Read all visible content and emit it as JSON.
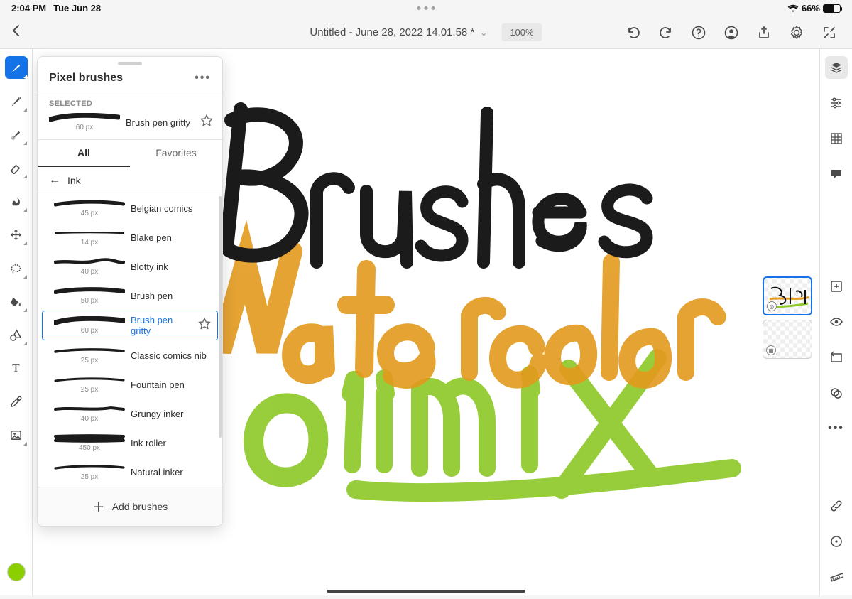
{
  "status": {
    "time": "2:04 PM",
    "date": "Tue Jun 28",
    "battery_pct": "66%"
  },
  "header": {
    "title": "Untitled - June 28, 2022 14.01.58 *",
    "zoom": "100%"
  },
  "popover": {
    "title": "Pixel brushes",
    "selected_label": "SELECTED",
    "tabs": {
      "all": "All",
      "favorites": "Favorites"
    },
    "category": "Ink",
    "selected_brush": {
      "name": "Brush pen gritty",
      "size": "60 px"
    },
    "brushes": [
      {
        "name": "Belgian comics",
        "size": "45 px"
      },
      {
        "name": "Blake pen",
        "size": "14 px"
      },
      {
        "name": "Blotty ink",
        "size": "40 px"
      },
      {
        "name": "Brush pen",
        "size": "50 px"
      },
      {
        "name": "Brush pen gritty",
        "size": "60 px"
      },
      {
        "name": "Classic comics nib",
        "size": "25 px"
      },
      {
        "name": "Fountain pen",
        "size": "25 px"
      },
      {
        "name": "Grungy inker",
        "size": "40 px"
      },
      {
        "name": "Ink roller",
        "size": "450 px"
      },
      {
        "name": "Natural inker",
        "size": "25 px"
      }
    ],
    "add_label": "Add brushes"
  },
  "left_tools": [
    "pixel-brush",
    "vector-brush",
    "watercolor-brush",
    "eraser",
    "smudge",
    "transform",
    "lasso",
    "fill",
    "shapes",
    "text",
    "eyedropper",
    "image-placer"
  ],
  "right_tools": [
    "layers",
    "properties",
    "grid",
    "comment",
    "add-layer",
    "visibility",
    "flip",
    "appearance",
    "more"
  ],
  "bottom_tools": [
    "link",
    "rotate",
    "ruler"
  ],
  "colors": {
    "swatch": "#8ccf00"
  },
  "canvas_text": {
    "line1": "Brushes",
    "line2": "Watercolor",
    "line3": "Oilmix"
  }
}
